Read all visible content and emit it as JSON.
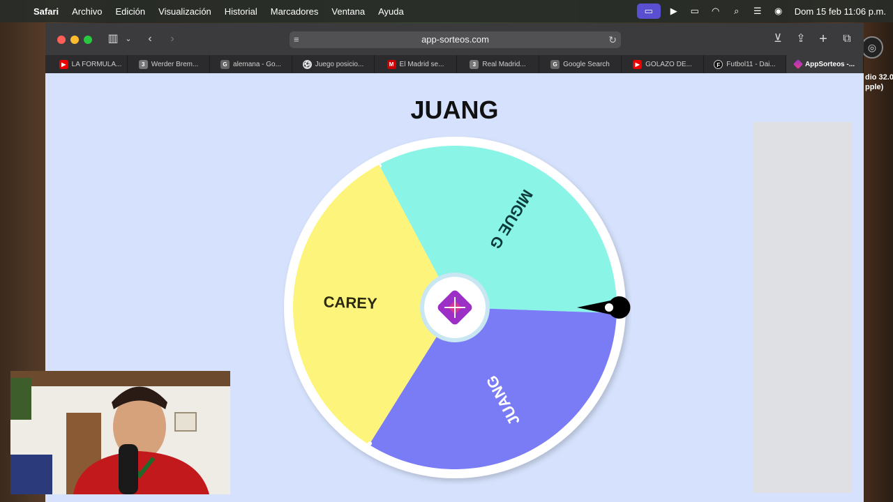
{
  "menubar": {
    "app_name": "Safari",
    "items": [
      "Archivo",
      "Edición",
      "Visualización",
      "Historial",
      "Marcadores",
      "Ventana",
      "Ayuda"
    ],
    "clock": "Dom 15 feb 11:06 p.m."
  },
  "background_window": {
    "text": "dio 32.0\npple)"
  },
  "browser": {
    "url": "app-sorteos.com",
    "tabs": [
      {
        "label": "LA FÓRMULA...",
        "icon": "youtube-icon",
        "active": false
      },
      {
        "label": "Werder Brem...",
        "icon": "3",
        "active": false
      },
      {
        "label": "alemana - Go...",
        "icon": "G",
        "active": false
      },
      {
        "label": "Juego posicio...",
        "icon": "round-icon",
        "active": false
      },
      {
        "label": "El Madrid se...",
        "icon": "M",
        "active": false
      },
      {
        "label": "Real Madrid...",
        "icon": "3",
        "active": false
      },
      {
        "label": "Google Search",
        "icon": "G",
        "active": false
      },
      {
        "label": "GOLAZO DE...",
        "icon": "youtube-icon",
        "active": false
      },
      {
        "label": "Futbol11 - Dai...",
        "icon": "F11",
        "active": false
      },
      {
        "label": "AppSorteos -...",
        "icon": "appsorteos-icon",
        "active": true
      }
    ]
  },
  "page": {
    "winner_title": "JUANG",
    "wheel": {
      "segments": [
        {
          "label": "MIGUE G",
          "color": "#8af5e7"
        },
        {
          "label": "JUANG",
          "color": "#7a7cf5"
        },
        {
          "label": "CAREY",
          "color": "#fdf57b"
        }
      ],
      "pointer_color": "#000000",
      "center_logo_colors": [
        "#9b2fc6",
        "#e2388a"
      ]
    }
  },
  "colors": {
    "page_background": "#d6e2fd",
    "ad_panel": "#dfe0e3"
  }
}
